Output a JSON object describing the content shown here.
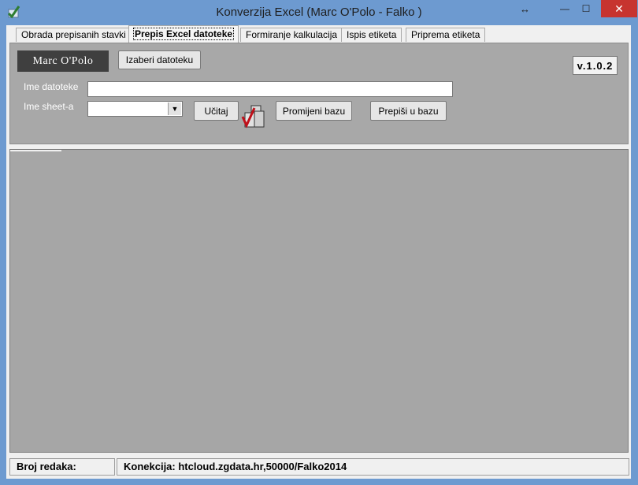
{
  "window": {
    "title": "Konverzija Excel (Marc O'Polo - Falko )",
    "resize_icon": "↔",
    "minimize_icon": "—",
    "maximize_icon": "☐",
    "close_icon": "✕"
  },
  "tabs": [
    {
      "label": "Obrada prepisanih stavki",
      "active": false
    },
    {
      "label": "Prepis Excel datoteke",
      "active": true
    },
    {
      "label": "Formiranje kalkulacija",
      "active": false
    },
    {
      "label": "Ispis etiketa",
      "active": false
    },
    {
      "label": "Priprema etiketa",
      "active": false
    }
  ],
  "panel": {
    "logo_text": "Marc O'Polo",
    "choose_file_button": "Izaberi datoteku",
    "version": "v.1.0.2",
    "filename_label": "Ime datoteke",
    "filename_value": "",
    "sheet_label": "Ime sheet-a",
    "sheet_value": "",
    "load_button": "Učitaj",
    "change_db_button": "Promijeni bazu",
    "copy_to_db_button": "Prepiši u bazu"
  },
  "status": {
    "row_count": "Broj redaka:",
    "connection": "Konekcija: htcloud.zgdata.hr,50000/Falko2014"
  },
  "colors": {
    "titlebar": "#6d9ad0",
    "close": "#c7342f",
    "panel": "#a8a8a8",
    "grid": "#a6a6a6"
  }
}
